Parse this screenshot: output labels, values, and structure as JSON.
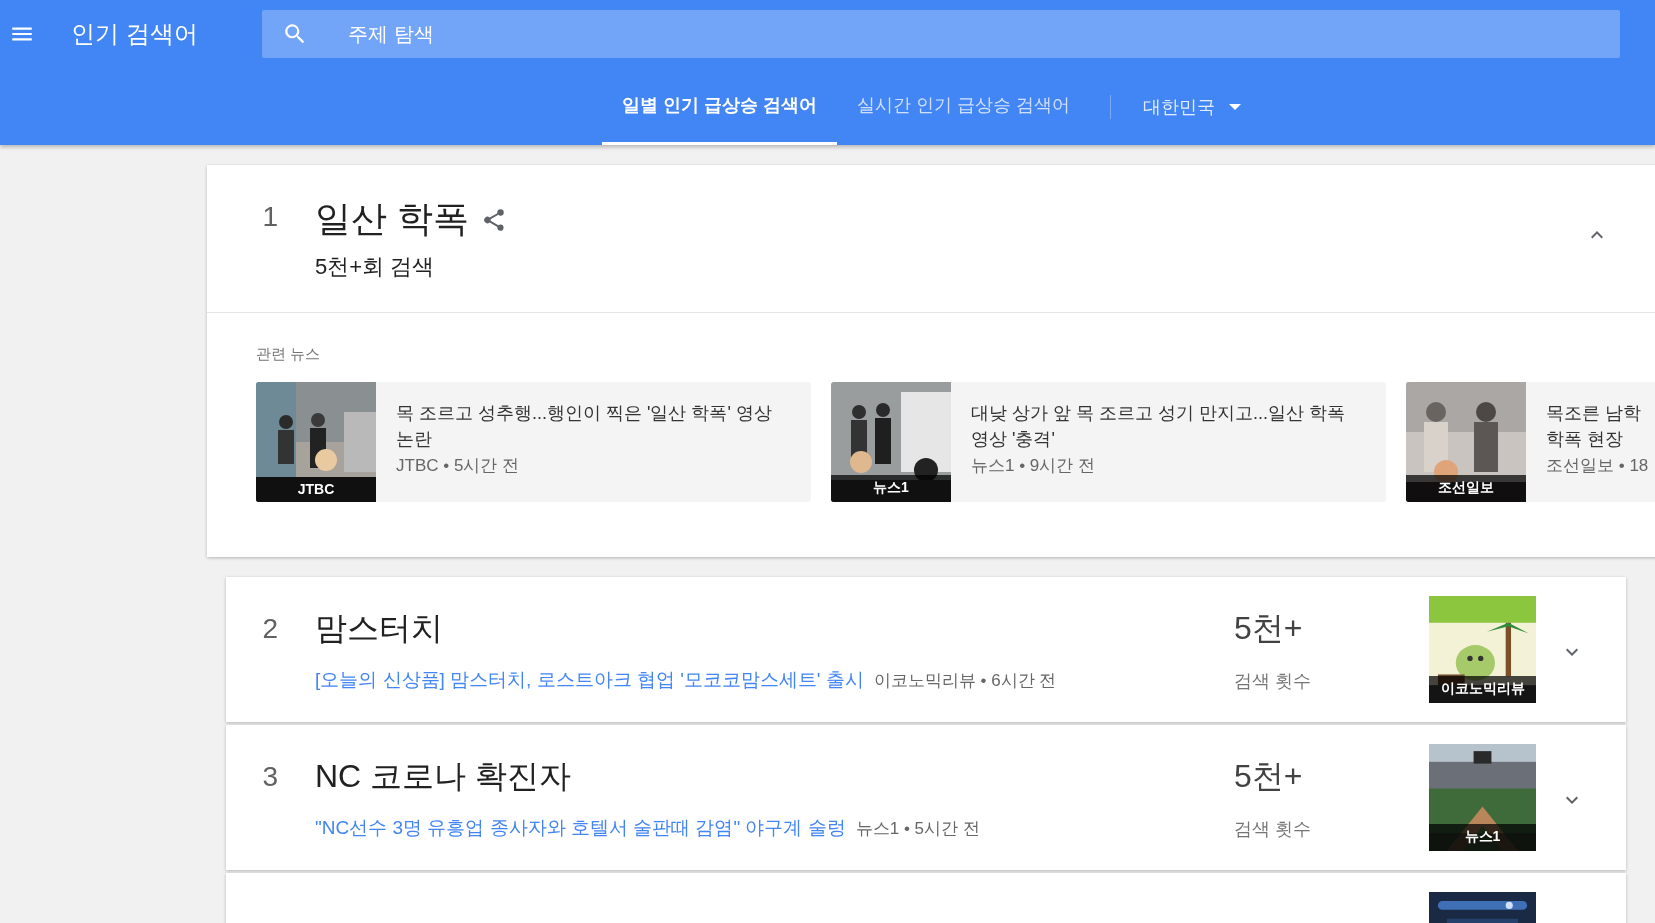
{
  "app_bar": {
    "title": "인기 검색어",
    "search": {
      "placeholder": "주제 탐색"
    }
  },
  "tabs": [
    {
      "label": "일별 인기 급상승 검색어",
      "selected": true
    },
    {
      "label": "실시간 인기 급상승 검색어",
      "selected": false
    }
  ],
  "region": {
    "label": "대한민국"
  },
  "trends": [
    {
      "rank": "1",
      "title": "일산 학폭",
      "searches": "5천+회 검색",
      "expanded": true,
      "news_heading": "관련 뉴스",
      "news": [
        {
          "headline": "목 조르고 성추행...행인이 찍은 '일산 학폭' 영상 논란",
          "meta": "JTBC • 5시간 전",
          "source": "JTBC",
          "thumbnail": {
            "kind": "picture"
          }
        },
        {
          "headline": "대낮 상가 앞 목 조르고 성기 만지고...일산 학폭 영상 '충격'",
          "meta": "뉴스1 • 9시간 전",
          "source": "뉴스1",
          "thumbnail": {
            "kind": "picture"
          }
        },
        {
          "headline": "목조른 남학\n학폭 현장",
          "meta": "조선일보 • 18",
          "source": "조선일보",
          "thumbnail": {
            "kind": "picture"
          }
        }
      ]
    },
    {
      "rank": "2",
      "title": "맘스터치",
      "expanded": false,
      "article": "[오늘의 신상품] 맘스터치, 로스트아크 협업 '모코코맘스세트' 출시",
      "meta": "이코노믹리뷰 • 6시간 전",
      "count": "5천+",
      "count_label": "검색 횟수",
      "source": "이코노믹리뷰",
      "thumbnail": {
        "kind": "picture"
      }
    },
    {
      "rank": "3",
      "title": "NC 코로나 확진자",
      "expanded": false,
      "article": "\"NC선수 3명 유흥업 종사자와 호텔서 술판때 감염\" 야구계 술렁",
      "meta": "뉴스1 • 5시간 전",
      "count": "5천+",
      "count_label": "검색 횟수",
      "source": "뉴스1",
      "thumbnail": {
        "kind": "picture"
      }
    },
    {
      "thumbnail": {
        "kind": "picture"
      }
    }
  ]
}
